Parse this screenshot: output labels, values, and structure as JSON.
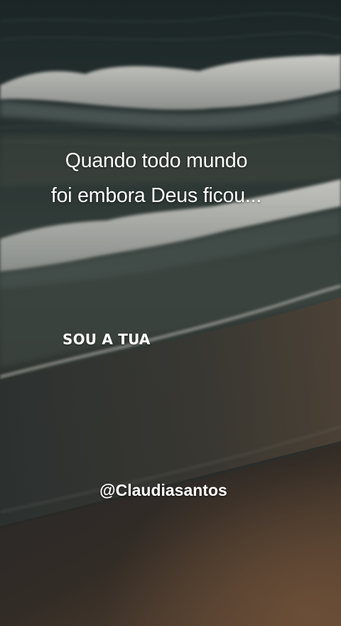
{
  "quote": {
    "line1": "Quando todo mundo",
    "line2": "foi embora Deus ficou..."
  },
  "lyric": "SOU A TUA",
  "handle": "@Claudiasantos",
  "colors": {
    "sea_dark": "#1c2628",
    "sea_mid": "#2f3a38",
    "foam": "#d9d8d2",
    "sand_dark": "#2d2823",
    "sand_warm": "#5a4534",
    "text": "#ffffff"
  }
}
